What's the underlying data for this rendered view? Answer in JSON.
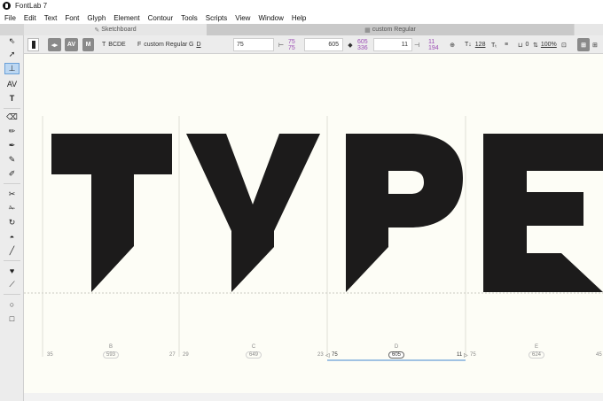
{
  "app": {
    "title": "FontLab 7"
  },
  "menu": [
    "File",
    "Edit",
    "Text",
    "Font",
    "Glyph",
    "Element",
    "Contour",
    "Tools",
    "Scripts",
    "View",
    "Window",
    "Help"
  ],
  "tabs": [
    {
      "label": "Sketchboard",
      "icon": "sketch-icon"
    },
    {
      "label": "custom Regular",
      "icon": "grid-icon"
    }
  ],
  "propbar": {
    "text_field": "BCDE",
    "font_field": "custom Regular",
    "glyph_field": "D",
    "lsb": "75",
    "lsb_stack": [
      "75",
      "75"
    ],
    "adv": "605",
    "adv_stack": [
      "605",
      "336"
    ],
    "rsb": "11",
    "rsb_stack": [
      "11",
      "194"
    ],
    "size": "128",
    "tracking": "0",
    "zoom": "100%"
  },
  "glyphs": [
    {
      "name": "B",
      "width": "593",
      "lsb": "35",
      "rsb": "27"
    },
    {
      "name": "C",
      "width": "649",
      "lsb": "29",
      "rsb": "23"
    },
    {
      "name": "D",
      "width": "605",
      "lsb": "75",
      "rsb": "11"
    },
    {
      "name": "E",
      "width": "624",
      "lsb": "75",
      "rsb": "45"
    }
  ],
  "colors": {
    "glyph_fill": "#1c1b1b",
    "canvas_bg": "#fdfdf6",
    "selection": "#6aa0d8",
    "metric_purple": "#9c4db5"
  }
}
